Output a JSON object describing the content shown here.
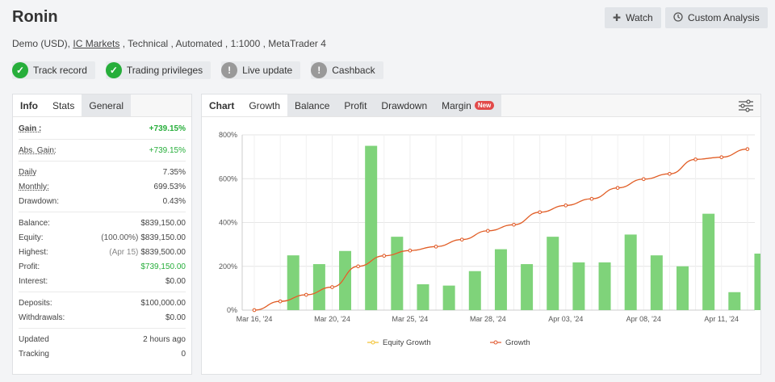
{
  "header": {
    "title": "Ronin",
    "subtitle_pre": "Demo (USD),",
    "subtitle_link": "IC Markets",
    "subtitle_post": ", Technical , Automated , 1:1000 , MetaTrader 4",
    "watch_label": "Watch",
    "analysis_label": "Custom Analysis"
  },
  "badges": [
    {
      "label": "Track record",
      "status": "ok"
    },
    {
      "label": "Trading privileges",
      "status": "ok"
    },
    {
      "label": "Live update",
      "status": "na"
    },
    {
      "label": "Cashback",
      "status": "na"
    }
  ],
  "left_tabs": [
    "Info",
    "Stats",
    "General"
  ],
  "stats": {
    "gain_label": "Gain :",
    "gain": "+739.15%",
    "abs_gain_label": "Abs. Gain:",
    "abs_gain": "+739.15%",
    "daily_label": "Daily",
    "daily": "7.35%",
    "monthly_label": "Monthly:",
    "monthly": "699.53%",
    "drawdown_label": "Drawdown:",
    "drawdown": "0.43%",
    "balance_label": "Balance:",
    "balance": "$839,150.00",
    "equity_label": "Equity:",
    "equity_sub": "(100.00%)",
    "equity": "$839,150.00",
    "highest_label": "Highest:",
    "highest_sub": "(Apr 15)",
    "highest": "$839,500.00",
    "profit_label": "Profit:",
    "profit": "$739,150.00",
    "interest_label": "Interest:",
    "interest": "$0.00",
    "deposits_label": "Deposits:",
    "deposits": "$100,000.00",
    "withdrawals_label": "Withdrawals:",
    "withdrawals": "$0.00",
    "updated_label": "Updated",
    "updated": "2 hours ago",
    "tracking_label": "Tracking",
    "tracking": "0"
  },
  "chart_tabs": {
    "chart": "Chart",
    "growth": "Growth",
    "balance": "Balance",
    "profit": "Profit",
    "drawdown": "Drawdown",
    "margin": "Margin",
    "new_badge": "New"
  },
  "colors": {
    "bar": "#7fd37a",
    "growth_line": "#e0582e",
    "equity_line": "#f2c12e",
    "ok": "#27ae3b"
  },
  "chart_data": {
    "type": "bar+line",
    "ylim": [
      0,
      800
    ],
    "ytick_labels": [
      "0%",
      "200%",
      "400%",
      "600%",
      "800%"
    ],
    "x_labels": [
      {
        "index": 0,
        "label": "Mar 16, '24"
      },
      {
        "index": 3,
        "label": "Mar 20, '24"
      },
      {
        "index": 6,
        "label": "Mar 25, '24"
      },
      {
        "index": 9,
        "label": "Mar 28, '24"
      },
      {
        "index": 12,
        "label": "Apr 03, '24"
      },
      {
        "index": 15,
        "label": "Apr 08, '24"
      },
      {
        "index": 18,
        "label": "Apr 11, '24"
      }
    ],
    "bars": [
      null,
      250,
      210,
      270,
      750,
      335,
      118,
      112,
      178,
      278,
      210,
      335,
      218,
      218,
      345,
      250,
      200,
      440,
      82,
      258
    ],
    "series": [
      {
        "name": "Equity Growth",
        "values": [
          0,
          40,
          70,
          105,
          200,
          248,
          272,
          290,
          322,
          362,
          390,
          447,
          478,
          508,
          558,
          598,
          622,
          688,
          698,
          735
        ]
      },
      {
        "name": "Growth",
        "values": [
          0,
          40,
          70,
          105,
          200,
          248,
          272,
          290,
          322,
          362,
          390,
          447,
          478,
          508,
          558,
          598,
          622,
          688,
          698,
          735
        ]
      }
    ]
  }
}
